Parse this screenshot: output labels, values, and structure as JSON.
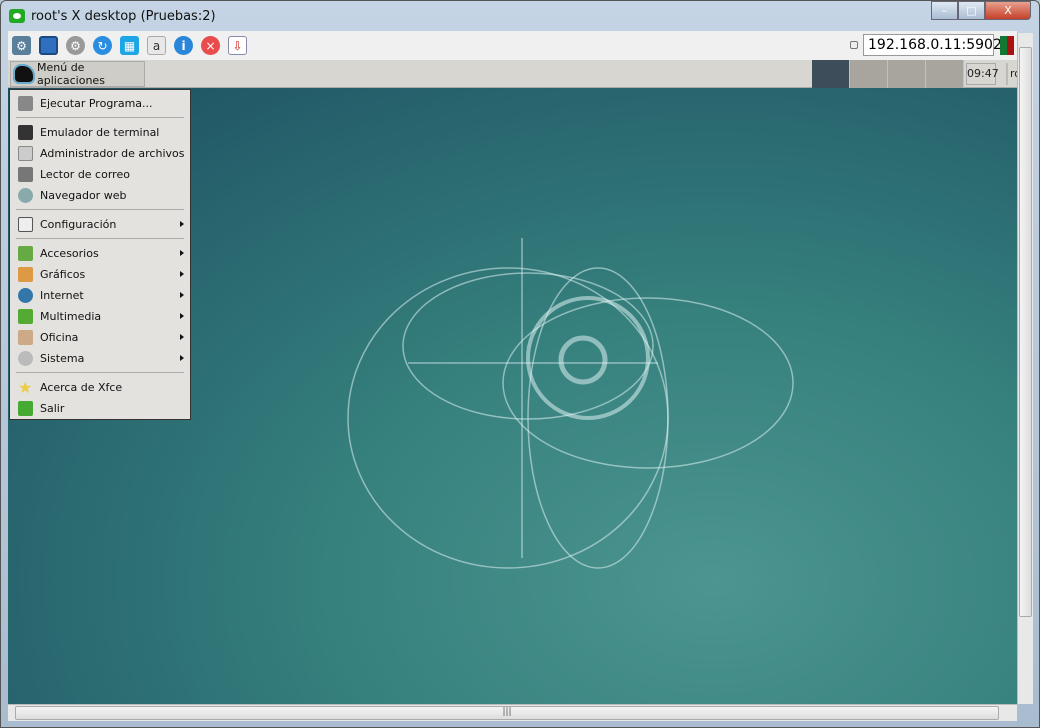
{
  "window": {
    "title": "root's X desktop (Pruebas:2)",
    "minimize": "–",
    "maximize": "□",
    "close": "X"
  },
  "toolbar": {
    "icons": [
      "options-icon",
      "fullscreen-icon",
      "settings-icon",
      "refresh-icon",
      "windows-key-icon",
      "ctrl-alt-del-icon",
      "info-icon",
      "disconnect-icon",
      "transfer-icon"
    ],
    "address": "192.168.0.11:5902"
  },
  "panel": {
    "menu_label": "Menú de aplicaciones",
    "clock": "09:47",
    "user": "ro"
  },
  "menu": {
    "items": [
      {
        "label": "Ejecutar Programa...",
        "color": "#888"
      },
      {
        "label": "Emulador de terminal",
        "color": "#333"
      },
      {
        "label": "Administrador de archivos",
        "color": "#bbb"
      },
      {
        "label": "Lector de correo",
        "color": "#777"
      },
      {
        "label": "Navegador web",
        "color": "#8aa"
      },
      {
        "label": "Configuración",
        "color": "#666"
      },
      {
        "label": "Accesorios",
        "color": "#6a4"
      },
      {
        "label": "Gráficos",
        "color": "#d94"
      },
      {
        "label": "Internet",
        "color": "#37a"
      },
      {
        "label": "Multimedia",
        "color": "#5a3"
      },
      {
        "label": "Oficina",
        "color": "#ca8"
      },
      {
        "label": "Sistema",
        "color": "#aaa"
      },
      {
        "label": "Acerca de Xfce",
        "color": "#ed5"
      },
      {
        "label": "Salir",
        "color": "#4a3"
      }
    ]
  }
}
